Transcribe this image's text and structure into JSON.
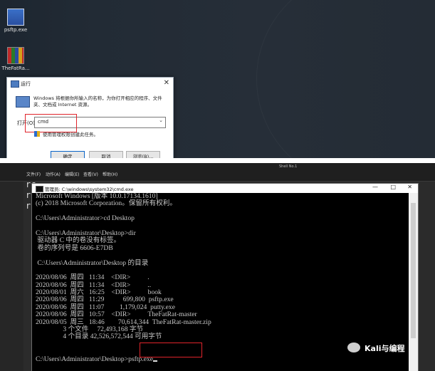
{
  "desktop": {
    "icons": [
      {
        "label": "psftp.exe",
        "icon": "psftp-icon"
      },
      {
        "label": "TheFatRa...",
        "icon": "winrar-icon"
      }
    ]
  },
  "run_dialog": {
    "title": "运行",
    "description": "Windows 将根据你所输入的名称，为你打开相应的程序、文件夹、文档或 Internet 资源。",
    "open_label": "打开(O):",
    "command_value": "cmd",
    "admin_note": "使用管理权限创建此任务。",
    "buttons": [
      "确定",
      "取消",
      "浏览(B)..."
    ]
  },
  "explorer_menu": {
    "items": [
      "文件(F)",
      "动作(A)",
      "编辑(E)",
      "查看(V)",
      "帮助(H)"
    ],
    "shell_label": "Shell No.1"
  },
  "background_terminal": {
    "prompts": [
      "rc",
      "rc",
      "rc"
    ]
  },
  "cmd_window": {
    "title": "管理员: C:\\windows\\system32\\cmd.exe",
    "window_controls": [
      "—",
      "□",
      "✕"
    ],
    "lines": [
      "Microsoft Windows [版本 10.0.17134.1610]",
      "(c) 2018 Microsoft Corporation。保留所有权利。",
      "",
      "C:\\Users\\Administrator>cd Desktop",
      "",
      "C:\\Users\\Administrator\\Desktop>dir",
      " 驱动器 C 中的卷没有标签。",
      " 卷的序列号是 6606-E7DB",
      "",
      " C:\\Users\\Administrator\\Desktop 的目录",
      "",
      "2020/08/06  周四   11:34    <DIR>          .",
      "2020/08/06  周四   11:34    <DIR>          ..",
      "2020/08/01  周六   16:25    <DIR>          book",
      "2020/08/06  周四   11:29           699,800  psftp.exe",
      "2020/08/06  周四   11:07         1,179,024  putty.exe",
      "2020/08/06  周四   10:57    <DIR>          TheFatRat-master",
      "2020/08/05  周三   18:46        70,614,344  TheFatRat-master.zip",
      "                3 个文件     72,493,168 字节",
      "                4 个目录 42,526,572,544 可用字节",
      "",
      ""
    ],
    "final_prompt": "C:\\Users\\Administrator\\Desktop>",
    "final_command": "psftp.exe"
  },
  "watermark": {
    "text": "Kali与编程"
  },
  "colors": {
    "highlight_box": "#e0242b",
    "terminal_bg": "#000000",
    "terminal_text": "#c8c8c8"
  }
}
